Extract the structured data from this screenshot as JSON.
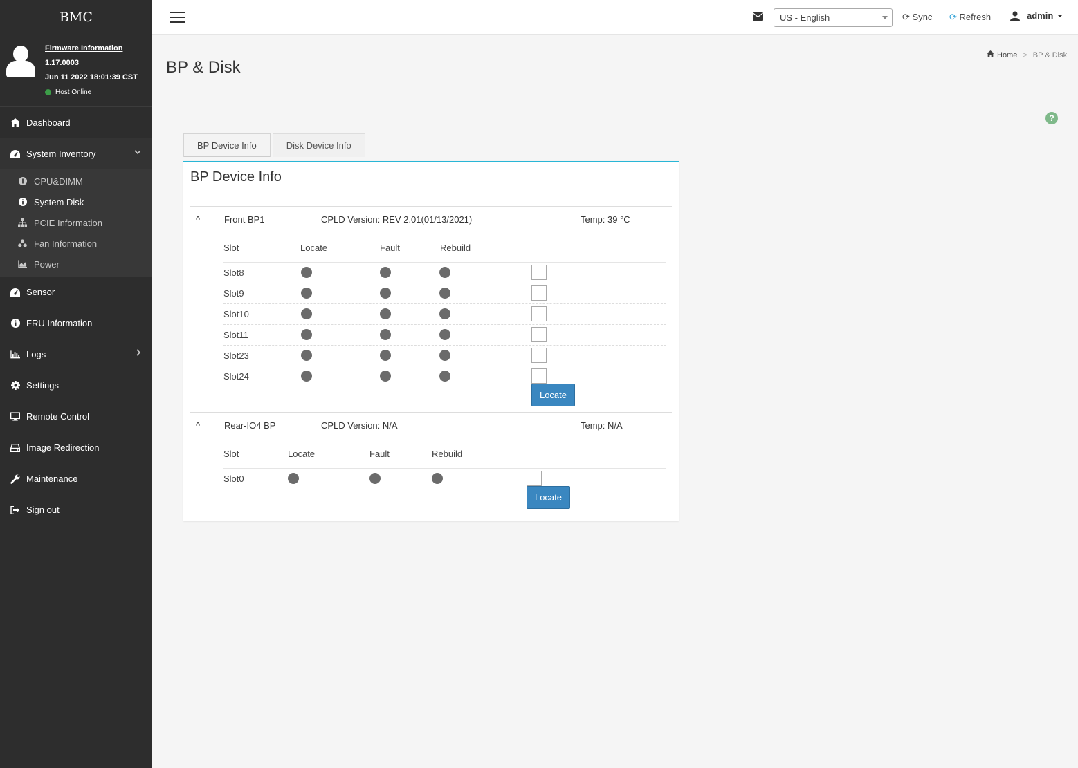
{
  "brand": "BMC",
  "user_panel": {
    "firmware_link": "Firmware Information",
    "firmware_version": "1.17.0003",
    "firmware_date": "Jun 11 2022 18:01:39 CST",
    "host_status": "Host Online",
    "host_status_color": "#3c9d48"
  },
  "menu": {
    "dashboard": "Dashboard",
    "system_inventory": "System Inventory",
    "sub": {
      "cpu_dimm": "CPU&DIMM",
      "system_disk": "System Disk",
      "pcie": "PCIE Information",
      "fan": "Fan Information",
      "power": "Power"
    },
    "sensor": "Sensor",
    "fru": "FRU Information",
    "logs": "Logs",
    "settings": "Settings",
    "remote_control": "Remote Control",
    "image_redirection": "Image Redirection",
    "maintenance": "Maintenance",
    "sign_out": "Sign out"
  },
  "topbar": {
    "language": "US - English",
    "sync": "Sync",
    "refresh": "Refresh",
    "user": "admin"
  },
  "page": {
    "title": "BP & Disk",
    "breadcrumb_home": "Home",
    "breadcrumb_sep": ">",
    "breadcrumb_current": "BP & Disk"
  },
  "tabs": {
    "bp": "BP Device Info",
    "disk": "Disk Device Info"
  },
  "panel": {
    "title": "BP Device Info",
    "toggle": "^",
    "columns": {
      "slot": "Slot",
      "locate": "Locate",
      "fault": "Fault",
      "rebuild": "Rebuild"
    },
    "locate_button": "Locate",
    "bp1": {
      "name": "Front BP1",
      "cpld": "CPLD Version: REV 2.01(01/13/2021)",
      "temp": "Temp: 39 °C",
      "slots": [
        "Slot8",
        "Slot9",
        "Slot10",
        "Slot11",
        "Slot23",
        "Slot24"
      ]
    },
    "bp2": {
      "name": "Rear-IO4 BP",
      "cpld": "CPLD Version: N/A",
      "temp": "Temp: N/A",
      "slots": [
        "Slot0"
      ]
    }
  },
  "colors": {
    "sidebar_bg": "#2d2d2d",
    "accent": "#29b6d6",
    "button": "#3a87c0",
    "led_off": "#6b6b6b"
  }
}
